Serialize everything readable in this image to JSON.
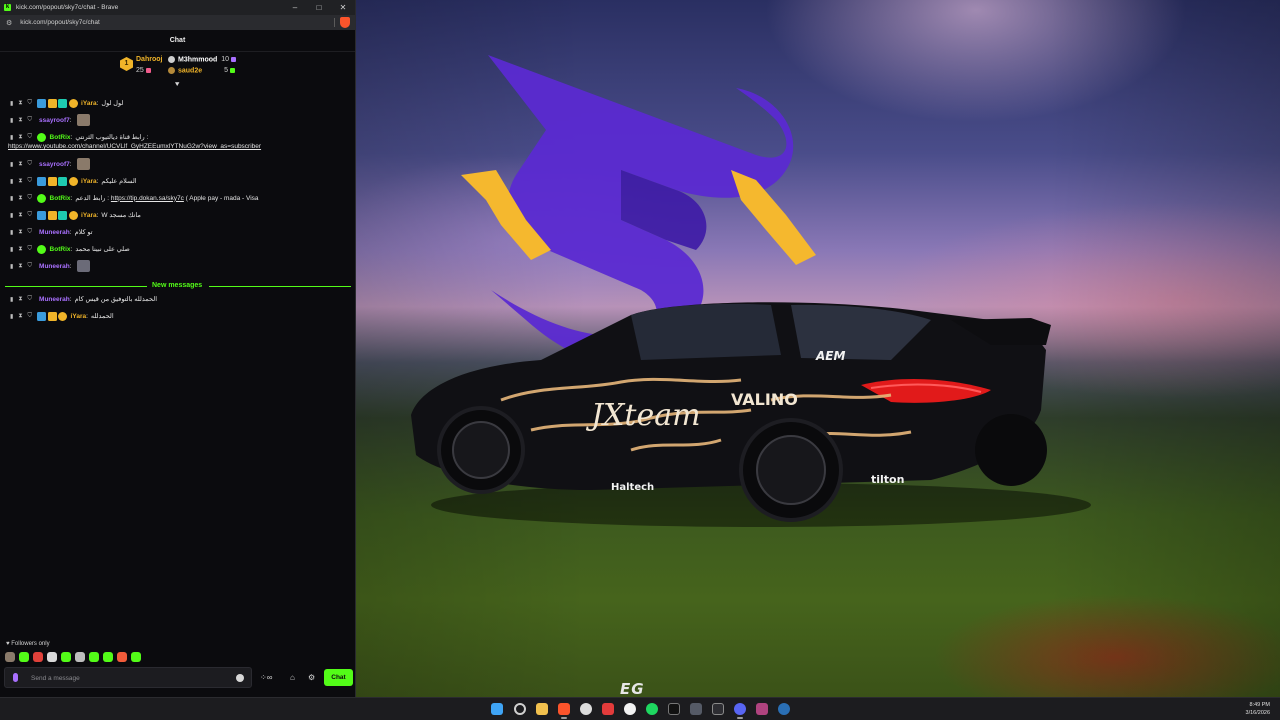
{
  "browser": {
    "window_title": "kick.com/popout/sky7c/chat - Brave",
    "url": "kick.com/popout/sky7c/chat",
    "favicon_letter": "k",
    "controls": [
      "–",
      "□",
      "✕"
    ]
  },
  "chat": {
    "header": "Chat",
    "top_gifters": [
      {
        "rank": "1",
        "name": "Dahrooj",
        "count": "25",
        "color": "#f0b429"
      },
      {
        "name": "M3hmmood",
        "count": "10",
        "color": "#ffffff"
      },
      {
        "name": "saud2e",
        "count": "5",
        "color": "#f0b429"
      }
    ],
    "messages": [
      {
        "user": "iYara",
        "color": "#f0b429",
        "text": "لول لول",
        "badges": [
          "#f0b429"
        ]
      },
      {
        "user": "ssayroof7",
        "color": "#a970ff",
        "text": "",
        "emote": true
      },
      {
        "user": "BotRix",
        "color": "#53fc18",
        "text": "رابط قناة ديالتيوب الثرنتي :",
        "badges": [
          "#53fc18"
        ]
      },
      {
        "user": "ssayroof7",
        "color": "#a970ff",
        "text": "",
        "emote": true
      },
      {
        "user": "iYara",
        "color": "#f0b429",
        "text": "السلام عليكم",
        "badges": [
          "#f0b429"
        ]
      },
      {
        "user": "BotRix",
        "color": "#53fc18",
        "text": "رابط الدعم :",
        "link": "https://tip.dokan.sa/sky7c",
        "suffix": "( Apple pay - mada - Visa",
        "badges": [
          "#53fc18"
        ]
      },
      {
        "user": "iYara",
        "color": "#f0b429",
        "text": "W مانك مسجد",
        "badges": [
          "#f0b429"
        ]
      },
      {
        "user": "Muneerah",
        "color": "#a970ff",
        "text": "تو كلام"
      },
      {
        "user": "BotRix",
        "color": "#53fc18",
        "text": "صلي على نبينا محمد",
        "badges": [
          "#53fc18"
        ]
      },
      {
        "user": "Muneerah",
        "color": "#a970ff",
        "text": "",
        "emote": true
      },
      {
        "user": "Muneerah",
        "color": "#a970ff",
        "text": "الحمدلله بالتوفيق من قيس كام"
      },
      {
        "user": "iYara",
        "color": "#f0b429",
        "text": "الحمدلله",
        "badges": [
          "#f0b429"
        ]
      }
    ],
    "youtube_link": "https://www.youtube.com/channel/UCVLlf_GyHZEEumxlYTNuG2w?view_as=subscriber",
    "new_messages_label": "New messages",
    "followers_only": "Followers only",
    "input_placeholder": "Send a message",
    "infinity_label": "∞",
    "send_label": "Chat"
  },
  "wallpaper": {
    "car_text_main": "JXteam",
    "car_text_side": "VALINO",
    "car_text_rear": "AEM",
    "car_text_tilton": "tilton",
    "car_text_haltech": "Haltech",
    "brand_mark": "EG"
  },
  "taskbar": {
    "time": "8:49 PM",
    "date": "3/16/2026"
  },
  "colors": {
    "kick_green": "#53fc18",
    "purple": "#a970ff",
    "gold": "#f0b429"
  }
}
